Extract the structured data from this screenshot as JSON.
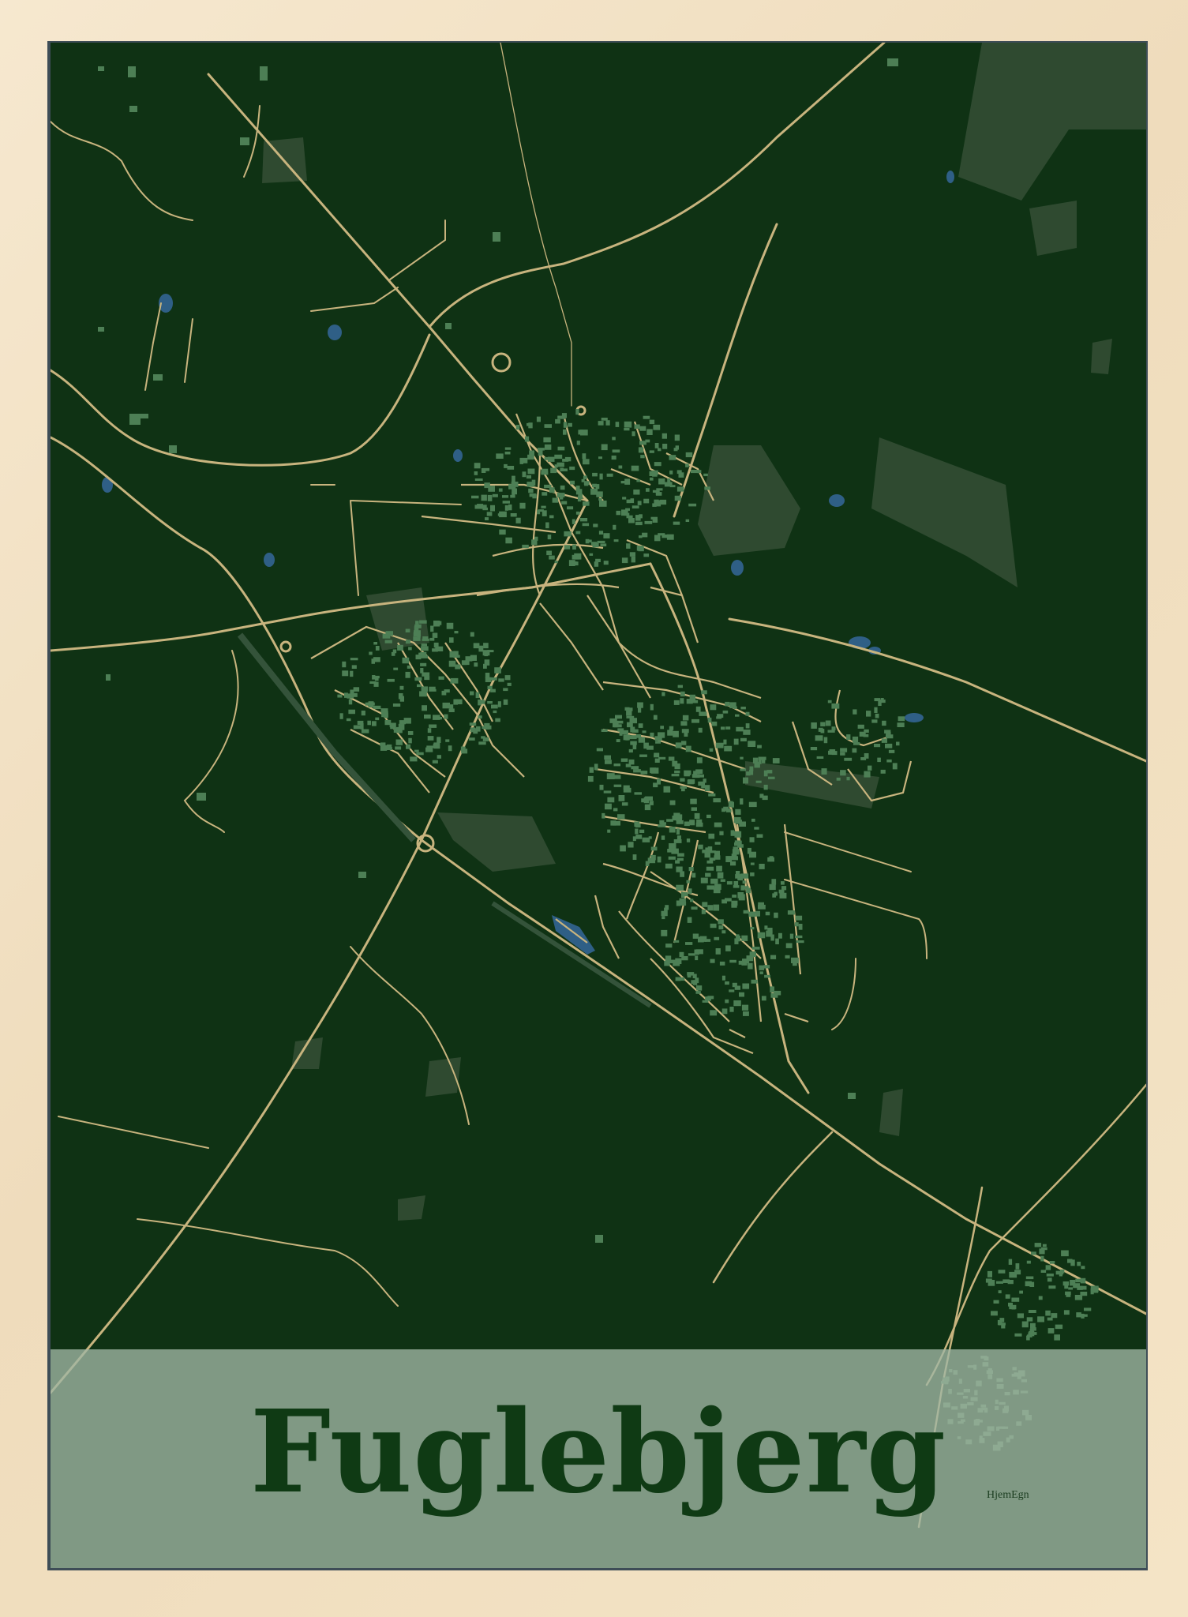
{
  "poster": {
    "title": "Fuglebjerg",
    "brand": "HjemEgn"
  },
  "colors": {
    "frame": "#f3e3c8",
    "background": "#0f3214",
    "roads": "#c8b47e",
    "buildings": "#4d7f55",
    "landuse": "#2f4a30",
    "water": "#2f5f86",
    "title_band": "#a0b6a4",
    "title_text": "#0f3a14"
  },
  "map": {
    "place": "Fuglebjerg",
    "features": [
      "roads",
      "buildings",
      "water",
      "landuse",
      "roundabouts",
      "railway"
    ]
  }
}
